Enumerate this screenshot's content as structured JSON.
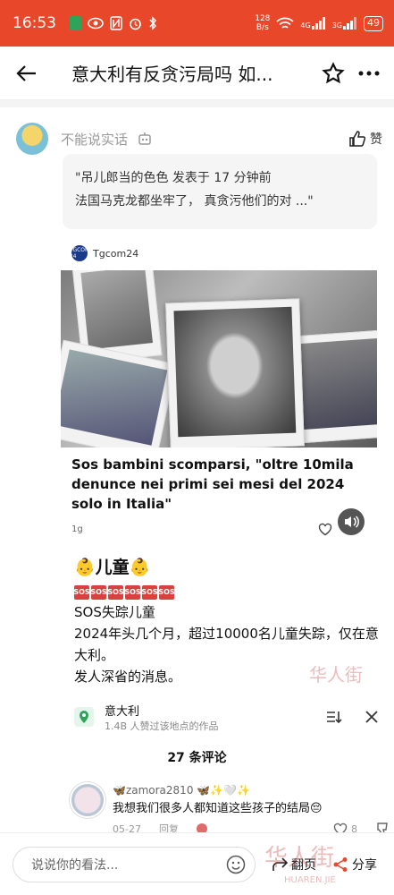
{
  "status_bar": {
    "time": "16:53",
    "net_speed_top": "128",
    "net_speed_bottom": "B/s",
    "sig1": "4G",
    "sig2": "3G",
    "battery": "49"
  },
  "header": {
    "title": "意大利有反贪污局吗 如..."
  },
  "author": {
    "name": "不能说实话",
    "like_label": "赞"
  },
  "quote": {
    "line1": "\"吊儿郎当的色色 发表于 17 分钟前",
    "line2": "法国马克龙都坐牢了， 真贪污他们的对 ...\""
  },
  "article": {
    "source": "Tgcom24",
    "source_logo_text": "TGCOM 24",
    "headline": "Sos bambini scomparsi, \"oltre 10mila denunce nei primi sei mesi del 2024 solo in Italia\"",
    "age": "1g"
  },
  "post": {
    "heading": "👶儿童👶",
    "sos_badges": [
      "SOS",
      "SOS",
      "SOS",
      "SOS",
      "SOS",
      "SOS"
    ],
    "line1": "SOS失踪儿童",
    "line2": "2024年头几个月，超过10000名儿童失踪，仅在意大利。",
    "line3": "发人深省的消息。"
  },
  "location": {
    "name": "意大利",
    "sub": "1.4B 人赞过该地点的作品"
  },
  "comments": {
    "count_label": "27 条评论",
    "items": [
      {
        "user": "🦋zamora2810 🦋✨🤍✨",
        "text": "我想我们很多人都知道这些孩子的结局😔",
        "date": "05-27",
        "reply": "回复",
        "likes": "8"
      }
    ]
  },
  "bottom": {
    "placeholder": "说说你的看法...",
    "action1": "翻页",
    "action2": "分享"
  },
  "watermark": {
    "text": "华人街",
    "sub": "HUAREN.JIE"
  },
  "colors": {
    "status_bar": "#e8472a",
    "sos": "#d94040"
  }
}
